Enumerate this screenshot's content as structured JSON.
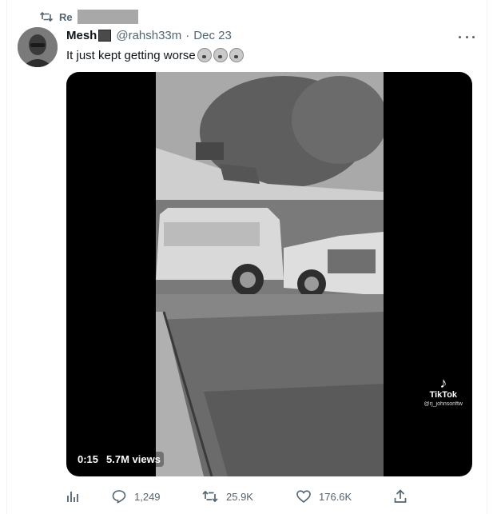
{
  "retweet": {
    "label_prefix": "Re"
  },
  "tweet": {
    "name": "Mesh",
    "handle": "@rahsh33m",
    "separator": "·",
    "date": "Dec 23",
    "text": "It just kept getting worse",
    "reaction_emoji_count": 3
  },
  "media": {
    "time": "0:15",
    "views": "5.7M views",
    "watermark": {
      "brand": "TikTok",
      "user": "@rj_johnsonftw"
    }
  },
  "actions": {
    "analytics_icon": "bar-chart-icon",
    "reply_count": "1,249",
    "retweet_count": "25.9K",
    "like_count": "176.6K",
    "share_icon": "share-icon"
  },
  "colors": {
    "secondary_text": "#536471",
    "primary_text": "#0f1419",
    "media_bg": "#000000"
  }
}
